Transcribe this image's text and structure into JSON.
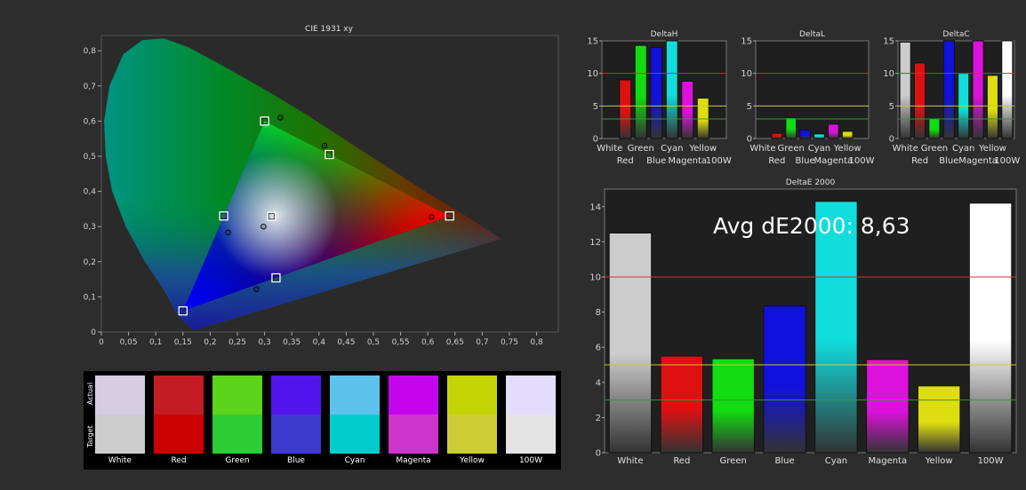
{
  "cie": {
    "title": "CIE 1931 xy",
    "x_ticks": [
      "0",
      "0,05",
      "0,1",
      "0,15",
      "0,2",
      "0,25",
      "0,3",
      "0,35",
      "0,4",
      "0,45",
      "0,5",
      "0,55",
      "0,6",
      "0,65",
      "0,7",
      "0,75",
      "0,8"
    ],
    "y_ticks": [
      "0",
      "0,1",
      "0,2",
      "0,3",
      "0,4",
      "0,5",
      "0,6",
      "0,7",
      "0,8"
    ],
    "gamut_target": [
      [
        0.64,
        0.33
      ],
      [
        0.3,
        0.6
      ],
      [
        0.15,
        0.06
      ]
    ],
    "targets": [
      {
        "name": "Red",
        "x": 0.64,
        "y": 0.33
      },
      {
        "name": "Green",
        "x": 0.3,
        "y": 0.6
      },
      {
        "name": "Blue",
        "x": 0.15,
        "y": 0.06
      },
      {
        "name": "Cyan",
        "x": 0.225,
        "y": 0.33
      },
      {
        "name": "Magenta",
        "x": 0.321,
        "y": 0.154
      },
      {
        "name": "Yellow",
        "x": 0.419,
        "y": 0.505
      },
      {
        "name": "White",
        "x": 0.3127,
        "y": 0.329
      }
    ],
    "measured": [
      {
        "name": "Red",
        "x": 0.607,
        "y": 0.327
      },
      {
        "name": "Green",
        "x": 0.329,
        "y": 0.61
      },
      {
        "name": "Cyan",
        "x": 0.233,
        "y": 0.283
      },
      {
        "name": "Magenta",
        "x": 0.285,
        "y": 0.122
      },
      {
        "name": "Yellow",
        "x": 0.41,
        "y": 0.53
      },
      {
        "name": "White",
        "x": 0.298,
        "y": 0.3
      }
    ]
  },
  "swatches": {
    "actual_label": "Actual",
    "target_label": "Target",
    "items": [
      {
        "name": "White",
        "actual": "#d4cde4",
        "target": "#cccccc"
      },
      {
        "name": "Red",
        "actual": "#c41c24",
        "target": "#cc0000"
      },
      {
        "name": "Green",
        "actual": "#5cd41c",
        "target": "#2ccc34"
      },
      {
        "name": "Blue",
        "actual": "#5414ec",
        "target": "#3c3ccc"
      },
      {
        "name": "Cyan",
        "actual": "#5cc4ec",
        "target": "#00cccc"
      },
      {
        "name": "Magenta",
        "actual": "#c404ec",
        "target": "#cc34cc"
      },
      {
        "name": "Yellow",
        "actual": "#c4d404",
        "target": "#cccc34"
      },
      {
        "name": "100W",
        "actual": "#e4dcfc",
        "target": "#e4e4e4"
      }
    ]
  },
  "chart_data": [
    {
      "type": "bar",
      "title": "DeltaH",
      "ylim": [
        0,
        15
      ],
      "y_ticks": [
        "0",
        "5",
        "10",
        "15"
      ],
      "categories": [
        "White",
        "Red",
        "Green",
        "Blue",
        "Cyan",
        "Magenta",
        "Yellow",
        "100W"
      ],
      "labels_top": [
        "White",
        "Green",
        "Cyan",
        "Yellow"
      ],
      "labels_bottom": [
        "Red",
        "Blue",
        "Magenta",
        "100W"
      ],
      "values": [
        0,
        9,
        14.3,
        14,
        15,
        8.8,
        6.2,
        0
      ],
      "colors": [
        "#cccccc",
        "#dd1111",
        "#11dd11",
        "#1111dd",
        "#11dddd",
        "#dd11dd",
        "#dddd11",
        "#ffffff"
      ],
      "thresholds": [
        {
          "value": 10,
          "color": "#cc3333"
        },
        {
          "value": 5,
          "color": "#cccc33"
        },
        {
          "value": 3,
          "color": "#339933"
        }
      ]
    },
    {
      "type": "bar",
      "title": "DeltaL",
      "ylim": [
        0,
        15
      ],
      "y_ticks": [
        "0",
        "5",
        "10",
        "15"
      ],
      "categories": [
        "White",
        "Red",
        "Green",
        "Blue",
        "Cyan",
        "Magenta",
        "Yellow",
        "100W"
      ],
      "labels_top": [
        "White",
        "Green",
        "Cyan",
        "Yellow"
      ],
      "labels_bottom": [
        "Red",
        "Blue",
        "Magenta",
        "100W"
      ],
      "values": [
        0,
        0.8,
        3.2,
        1.3,
        0.7,
        2.2,
        1.1,
        0
      ],
      "colors": [
        "#cccccc",
        "#dd1111",
        "#11dd11",
        "#1111dd",
        "#11dddd",
        "#dd11dd",
        "#dddd11",
        "#ffffff"
      ],
      "thresholds": [
        {
          "value": 10,
          "color": "#cc3333"
        },
        {
          "value": 5,
          "color": "#cccc33"
        },
        {
          "value": 3,
          "color": "#339933"
        }
      ]
    },
    {
      "type": "bar",
      "title": "DeltaC",
      "ylim": [
        0,
        15
      ],
      "y_ticks": [
        "0",
        "5",
        "10",
        "15"
      ],
      "categories": [
        "White",
        "Red",
        "Green",
        "Blue",
        "Cyan",
        "Magenta",
        "Yellow",
        "100W"
      ],
      "labels_top": [
        "White",
        "Green",
        "Cyan",
        "Yellow"
      ],
      "labels_bottom": [
        "Red",
        "Blue",
        "Magenta",
        "100W"
      ],
      "values": [
        14.8,
        11.6,
        3,
        15,
        10,
        15,
        9.7,
        15
      ],
      "colors": [
        "#cccccc",
        "#dd1111",
        "#11dd11",
        "#1111dd",
        "#11dddd",
        "#dd11dd",
        "#dddd11",
        "#ffffff"
      ],
      "thresholds": [
        {
          "value": 10,
          "color": "#cc3333"
        },
        {
          "value": 5,
          "color": "#cccc33"
        },
        {
          "value": 3,
          "color": "#339933"
        }
      ]
    },
    {
      "type": "bar",
      "title": "DeltaE 2000",
      "annotation": "Avg dE2000: 8,63",
      "ylim": [
        0,
        15
      ],
      "y_ticks": [
        "0",
        "2",
        "4",
        "6",
        "8",
        "10",
        "12",
        "14"
      ],
      "categories": [
        "White",
        "Red",
        "Green",
        "Blue",
        "Cyan",
        "Magenta",
        "Yellow",
        "100W"
      ],
      "values": [
        12.5,
        5.5,
        5.35,
        8.35,
        14.3,
        5.3,
        3.8,
        14.2
      ],
      "colors": [
        "#cccccc",
        "#dd1111",
        "#11dd11",
        "#1111dd",
        "#11dddd",
        "#dd11dd",
        "#dddd11",
        "#ffffff"
      ],
      "thresholds": [
        {
          "value": 10,
          "color": "#cc3333"
        },
        {
          "value": 5,
          "color": "#cccc33"
        },
        {
          "value": 3,
          "color": "#339933"
        }
      ]
    }
  ]
}
